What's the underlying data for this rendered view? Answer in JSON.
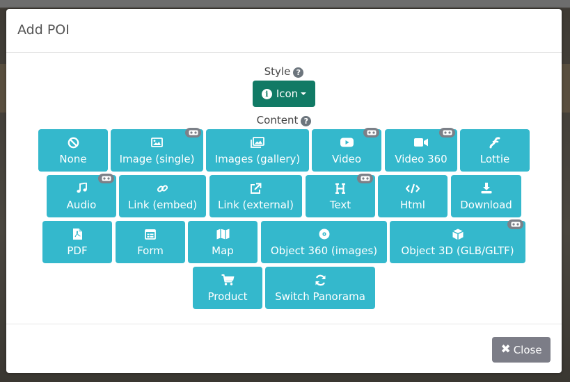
{
  "modal": {
    "title": "Add POI",
    "style_label": "Style",
    "style_button_label": "Icon",
    "content_label": "Content",
    "close_label": "Close"
  },
  "content_buttons": [
    {
      "label": "None",
      "icon": "ban-icon",
      "vr": false
    },
    {
      "label": "Image (single)",
      "icon": "image-icon",
      "vr": true
    },
    {
      "label": "Images (gallery)",
      "icon": "images-icon",
      "vr": false
    },
    {
      "label": "Video",
      "icon": "youtube-icon",
      "vr": true
    },
    {
      "label": "Video 360",
      "icon": "video-camera-icon",
      "vr": true
    },
    {
      "label": "Lottie",
      "icon": "lottie-icon",
      "vr": false
    },
    {
      "label": "Audio",
      "icon": "music-icon",
      "vr": true
    },
    {
      "label": "Link (embed)",
      "icon": "link-icon",
      "vr": false
    },
    {
      "label": "Link (external)",
      "icon": "external-link-icon",
      "vr": false
    },
    {
      "label": "Text",
      "icon": "heading-icon",
      "vr": true
    },
    {
      "label": "Html",
      "icon": "code-icon",
      "vr": false
    },
    {
      "label": "Download",
      "icon": "download-icon",
      "vr": false
    },
    {
      "label": "PDF",
      "icon": "pdf-file-icon",
      "vr": false
    },
    {
      "label": "Form",
      "icon": "form-icon",
      "vr": false
    },
    {
      "label": "Map",
      "icon": "map-icon",
      "vr": false
    },
    {
      "label": "Object 360 (images)",
      "icon": "disc-icon",
      "vr": false
    },
    {
      "label": "Object 3D (GLB/GLTF)",
      "icon": "cube-icon",
      "vr": true
    },
    {
      "label": "Product",
      "icon": "cart-icon",
      "vr": false
    },
    {
      "label": "Switch Panorama",
      "icon": "sync-icon",
      "vr": false
    }
  ],
  "colors": {
    "content_button": "#34b8cc",
    "style_button": "#117a65",
    "close_button": "#7c7d87",
    "vr_badge": "#7c8088"
  }
}
